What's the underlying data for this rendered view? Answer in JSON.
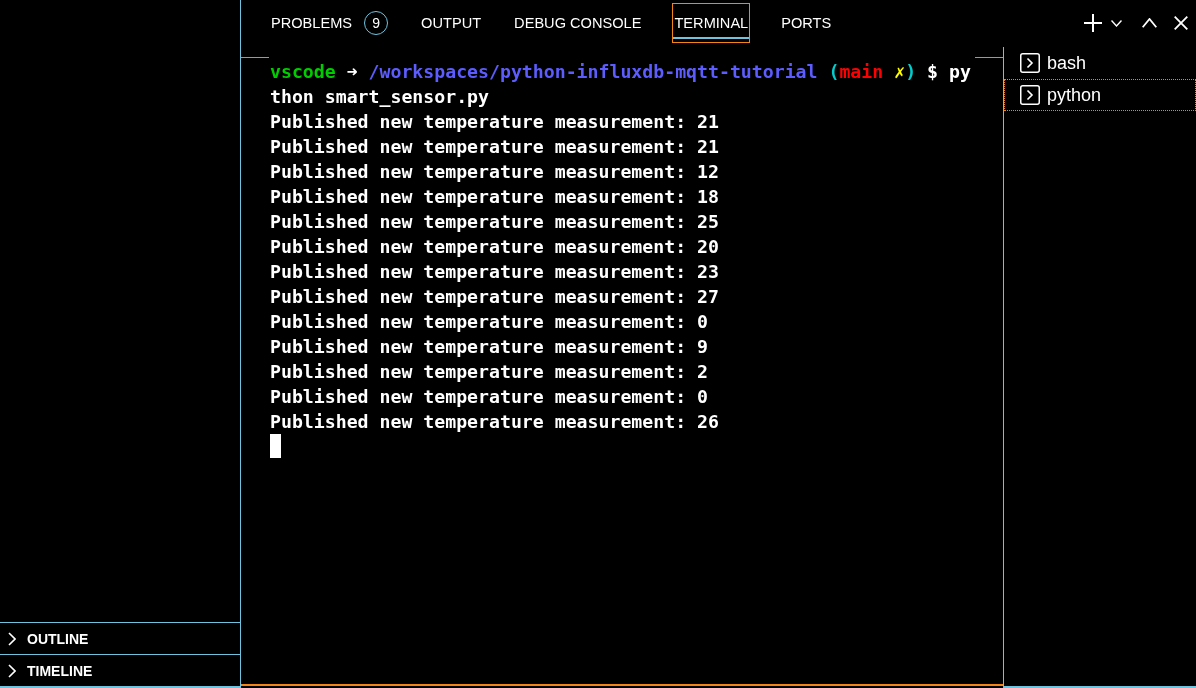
{
  "sidebar": {
    "sections": [
      {
        "label": "OUTLINE",
        "expanded": false
      },
      {
        "label": "TIMELINE",
        "expanded": false
      }
    ]
  },
  "panel_tabs": [
    {
      "label": "PROBLEMS",
      "badge": "9",
      "selected": false
    },
    {
      "label": "OUTPUT",
      "selected": false
    },
    {
      "label": "DEBUG CONSOLE",
      "selected": false
    },
    {
      "label": "TERMINAL",
      "selected": true
    },
    {
      "label": "PORTS",
      "selected": false
    }
  ],
  "terminal": {
    "prompt": [
      {
        "kind": "user",
        "text": "vscode"
      },
      {
        "kind": "arrow",
        "text": "➜"
      },
      {
        "kind": "path",
        "text": "/workspaces/python-influxdb-mqtt-tutorial"
      },
      {
        "kind": "paren_open",
        "text": "("
      },
      {
        "kind": "branch",
        "text": "main"
      },
      {
        "kind": "dirty",
        "text": "✗"
      },
      {
        "kind": "paren_close",
        "text": ")"
      },
      {
        "kind": "symbol",
        "text": "$"
      },
      {
        "kind": "command",
        "text": "py"
      }
    ],
    "lines": [
      "thon smart_sensor.py",
      "Published new temperature measurement: 21",
      "Published new temperature measurement: 21",
      "Published new temperature measurement: 12",
      "Published new temperature measurement: 18",
      "Published new temperature measurement: 25",
      "Published new temperature measurement: 20",
      "Published new temperature measurement: 23",
      "Published new temperature measurement: 27",
      "Published new temperature measurement: 0",
      "Published new temperature measurement: 9",
      "Published new temperature measurement: 2",
      "Published new temperature measurement: 0",
      "Published new temperature measurement: 26"
    ],
    "cursor": true
  },
  "terminal_list": [
    {
      "label": "bash",
      "selected": false
    },
    {
      "label": "python",
      "selected": true
    }
  ]
}
